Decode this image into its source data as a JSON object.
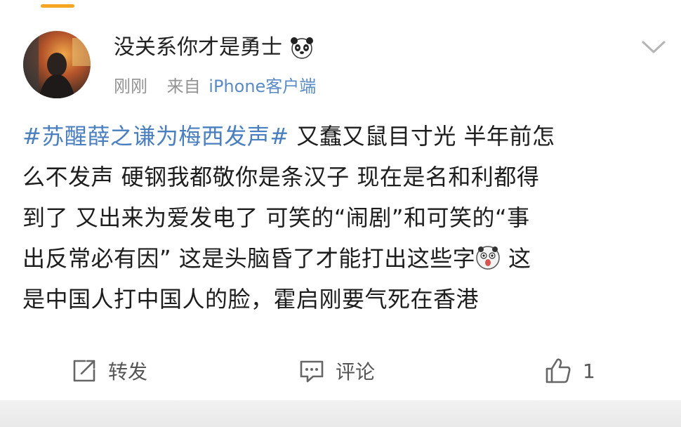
{
  "post": {
    "username": "没关系你才是勇士",
    "time": "刚刚",
    "from_label": "来自",
    "device": "iPhone客户端",
    "hashtag": "#苏醒薛之谦为梅西发声#",
    "text_line1": "又蠢又鼠目寸光 半年前怎",
    "text_line2": "么不发声 硬钢我都敬你是条汉子 现在是名和利都得",
    "text_line3": "到了 又出来为爱发电了 可笑的“闹剧”和可笑的“事",
    "text_line4": "出反常必有因” 这是头脑昏了才能打出这些字",
    "text_line4_after_emoji": "这",
    "text_line5": "是中国人打中国人的脸，霍启刚要气死在香港"
  },
  "actions": {
    "repost_label": "转发",
    "comment_label": "评论",
    "like_count": "1"
  },
  "icons": {
    "username_badge": "panda-icon",
    "menu": "chevron-down-icon",
    "inline_emoji": "shocked-face-emoji-icon",
    "repost": "repost-icon",
    "comment": "comment-icon",
    "like": "thumbs-up-icon"
  },
  "colors": {
    "hashtag": "#4a7fbf",
    "device": "#5a8bc6",
    "meta": "#939393",
    "accent": "#f5a623"
  }
}
